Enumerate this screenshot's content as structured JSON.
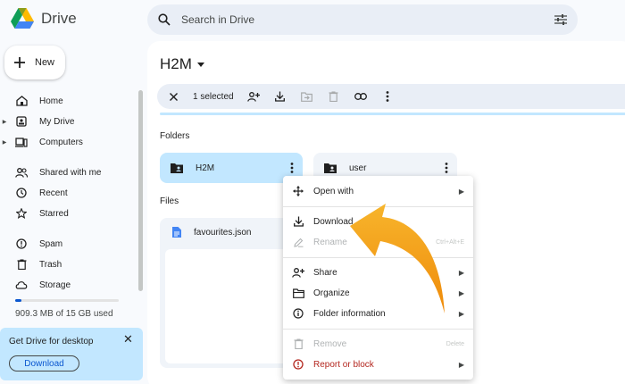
{
  "app": {
    "name": "Drive"
  },
  "search": {
    "placeholder": "Search in Drive"
  },
  "sidebar": {
    "new_label": "New",
    "items": [
      {
        "label": "Home",
        "icon": "home-icon"
      },
      {
        "label": "My Drive",
        "icon": "my-drive-icon",
        "expandable": true
      },
      {
        "label": "Computers",
        "icon": "computers-icon",
        "expandable": true
      },
      {
        "label": "Shared with me",
        "icon": "shared-icon"
      },
      {
        "label": "Recent",
        "icon": "clock-icon"
      },
      {
        "label": "Starred",
        "icon": "star-icon"
      },
      {
        "label": "Spam",
        "icon": "spam-icon"
      },
      {
        "label": "Trash",
        "icon": "trash-icon"
      },
      {
        "label": "Storage",
        "icon": "cloud-icon"
      }
    ],
    "storage_text": "909.3 MB of 15 GB used",
    "storage_used_fraction": 0.06,
    "promo": {
      "title": "Get Drive for desktop",
      "button": "Download"
    }
  },
  "main": {
    "title": "H2M",
    "toolbar": {
      "selected_text": "1 selected"
    },
    "folders_heading": "Folders",
    "files_heading": "Files",
    "folders": [
      {
        "name": "H2M",
        "selected": true
      },
      {
        "name": "user",
        "selected": false
      }
    ],
    "files": [
      {
        "name": "favourites.json"
      }
    ]
  },
  "context_menu": {
    "items": [
      {
        "label": "Open with",
        "icon": "open-with-icon",
        "submenu": true
      },
      {
        "label": "Download",
        "icon": "download-icon"
      },
      {
        "label": "Rename",
        "icon": "rename-icon",
        "shortcut": "Ctrl+Alt+E",
        "disabled": true
      },
      {
        "label": "Share",
        "icon": "share-icon",
        "submenu": true
      },
      {
        "label": "Organize",
        "icon": "organize-icon",
        "submenu": true
      },
      {
        "label": "Folder information",
        "icon": "info-icon",
        "submenu": true
      },
      {
        "label": "Remove",
        "icon": "trash-icon",
        "shortcut": "Delete",
        "disabled": true
      },
      {
        "label": "Report or block",
        "icon": "report-icon",
        "submenu": true,
        "danger": true
      }
    ]
  },
  "colors": {
    "accent": "#0b57d0",
    "selected": "#c2e7ff",
    "danger": "#b3261e",
    "arrow": "#f59a0c"
  }
}
